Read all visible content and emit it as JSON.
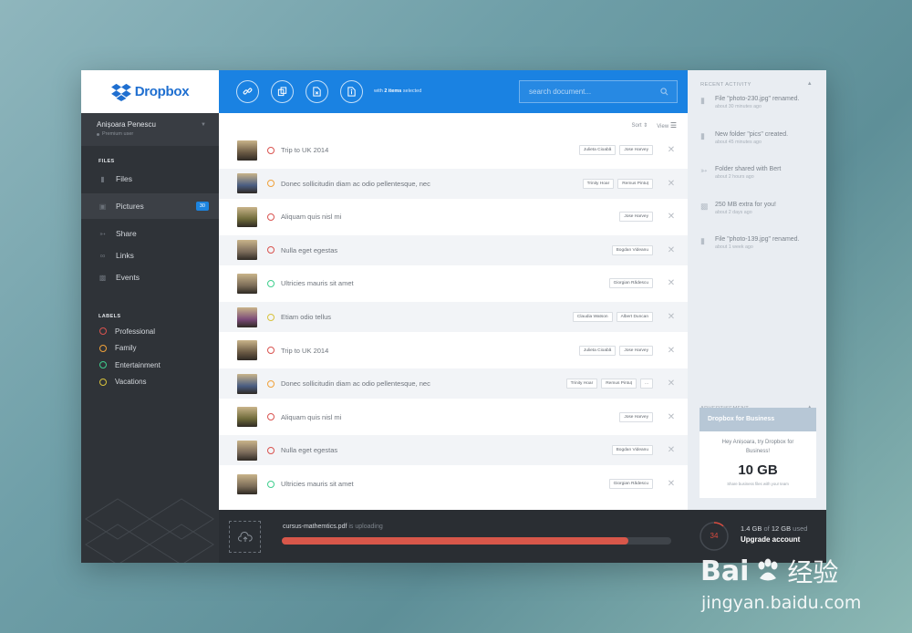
{
  "app": {
    "brand": "Dropbox"
  },
  "sidebar": {
    "user": {
      "name": "Anișoara Penescu",
      "plan": "Premium user"
    },
    "files_title": "FILES",
    "items": [
      {
        "label": "Files",
        "icon": "file-icon"
      },
      {
        "label": "Pictures",
        "icon": "picture-icon",
        "badge": "30",
        "active": true
      },
      {
        "label": "Share",
        "icon": "share-icon"
      },
      {
        "label": "Links",
        "icon": "link-icon"
      },
      {
        "label": "Events",
        "icon": "calendar-icon"
      }
    ],
    "labels_title": "LABELS",
    "labels": [
      {
        "label": "Professional",
        "color": "#d9534f"
      },
      {
        "label": "Family",
        "color": "#f0a13a"
      },
      {
        "label": "Entertainment",
        "color": "#3fcf8e"
      },
      {
        "label": "Vacations",
        "color": "#d8c23c"
      }
    ]
  },
  "toolbar": {
    "selection_prefix": "with",
    "selection_count": "2 items",
    "selection_suffix": "selected",
    "search_placeholder": "search document..."
  },
  "list": {
    "sort_label": "Sort",
    "view_label": "View",
    "rows": [
      {
        "title": "Trip to UK 2014",
        "status_color": "#d9534f",
        "tags": [
          "Julieta Cioabă",
          "Jose Harvey"
        ],
        "thumb": "#6b5a44"
      },
      {
        "title": "Donec sollicitudin diam ac odio pellentesque, nec",
        "status_color": "#f0a13a",
        "tags": [
          "Trinity Hoar",
          "Remus Pintuț"
        ],
        "thumb": "#4a5d82"
      },
      {
        "title": "Aliquam quis nisl mi",
        "status_color": "#d9534f",
        "tags": [
          "Jose Harvey"
        ],
        "thumb": "#6e6a3a"
      },
      {
        "title": "Nulla eget egestas",
        "status_color": "#d9534f",
        "tags": [
          "Bogdan Videanu"
        ],
        "thumb": "#7a6a5a"
      },
      {
        "title": "Ultricies mauris sit amet",
        "status_color": "#3fcf8e",
        "tags": [
          "Giorgian Rădescu"
        ],
        "thumb": "#7b6c58"
      },
      {
        "title": "Etiam odio tellus",
        "status_color": "#d8c23c",
        "tags": [
          "Claudia Watson",
          "Albert Duncan"
        ],
        "thumb": "#7b4a78"
      },
      {
        "title": "Trip to UK 2014",
        "status_color": "#d9534f",
        "tags": [
          "Julieta Cioabă",
          "Jose Harvey"
        ],
        "thumb": "#6b5a44"
      },
      {
        "title": "Donec sollicitudin diam ac odio pellentesque, nec",
        "status_color": "#f0a13a",
        "tags": [
          "Trinity Hoar",
          "Remus Pintuț",
          "..."
        ],
        "thumb": "#4a5d82"
      },
      {
        "title": "Aliquam quis nisl mi",
        "status_color": "#d9534f",
        "tags": [
          "Jose Harvey"
        ],
        "thumb": "#6e6a3a"
      },
      {
        "title": "Nulla eget egestas",
        "status_color": "#d9534f",
        "tags": [
          "Bogdan Videanu"
        ],
        "thumb": "#7a6a5a"
      },
      {
        "title": "Ultricies mauris sit amet",
        "status_color": "#3fcf8e",
        "tags": [
          "Giorgian Rădescu"
        ],
        "thumb": "#7b6c58"
      }
    ]
  },
  "activity": {
    "title": "RECENT ACTIVITY",
    "items": [
      {
        "text": "File \"photo-230.jpg\" renamed.",
        "time": "about 30 minutes ago",
        "icon": "file-icon"
      },
      {
        "text": "New folder \"pics\" created.",
        "time": "about 45 minutes ago",
        "icon": "folder-icon"
      },
      {
        "text": "Folder shared with Bert",
        "time": "about 2 hours ago",
        "icon": "share-icon"
      },
      {
        "text": "250 MB extra for you!",
        "time": "about 2 days ago",
        "icon": "gift-icon"
      },
      {
        "text": "File \"photo-139.jpg\" renamed.",
        "time": "about 1 week ago",
        "icon": "file-icon"
      }
    ]
  },
  "advertisement": {
    "title": "ADVERTISEMENT",
    "card_title": "Dropbox for Business",
    "message": "Hey Anișoara, try Dropbox for Business!",
    "amount": "10 GB",
    "note": "Share business files with your team"
  },
  "upload": {
    "filename": "cursus-mathemtics.pdf",
    "status": "is uploading",
    "progress": 0.89
  },
  "storage": {
    "gauge_value": "34",
    "used": "1.4 GB",
    "of_label": "of",
    "total": "12 GB",
    "suffix": "used",
    "upgrade_label": "Upgrade account",
    "accent": "#d94b3f"
  },
  "watermark": {
    "brand": "Bai",
    "brand2": "经验",
    "url": "jingyan.baidu.com"
  }
}
